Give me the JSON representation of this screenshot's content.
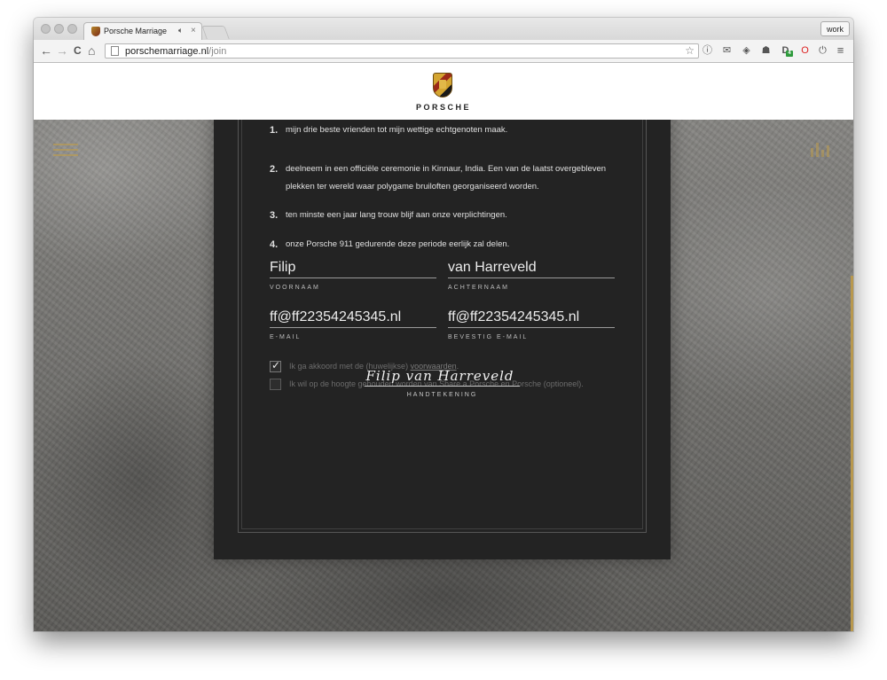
{
  "browser": {
    "tab": {
      "title": "Porsche Marriage",
      "sound_icon": "speaker-icon",
      "close": "×"
    },
    "profile": "work",
    "url": {
      "host": "porschemarriage.nl",
      "path": "/join"
    },
    "nav": {
      "back": "←",
      "forward": "→",
      "reload": "C",
      "home": "⌂"
    },
    "star": "☆",
    "extensions": [
      "1password-icon",
      "inbox-icon",
      "pocket-icon",
      "ghostery-icon",
      "downloads-icon",
      "opera-icon",
      "power-icon",
      "menu-icon"
    ],
    "extension_badge": "4"
  },
  "header": {
    "brand": "PORSCHE"
  },
  "clauses": [
    {
      "num": "1.",
      "text": "mijn drie beste vrienden tot mijn wettige echtgenoten maak."
    },
    {
      "num": "2.",
      "text": "deelneem in een officiële ceremonie in Kinnaur, India. Een van de laatst overgebleven plekken ter wereld waar polygame bruiloften georganiseerd worden."
    },
    {
      "num": "3.",
      "text": "ten minste een jaar lang trouw blijf aan onze verplichtingen."
    },
    {
      "num": "4.",
      "text": "onze Porsche 911 gedurende deze periode eerlijk zal delen."
    }
  ],
  "form": {
    "first_name": {
      "value": "Filip",
      "label": "VOORNAAM"
    },
    "last_name": {
      "value": "van Harreveld",
      "label": "ACHTERNAAM"
    },
    "email": {
      "value": "ff@ff22354245345.nl",
      "label": "E-MAIL"
    },
    "email_confirm": {
      "value": "ff@ff22354245345.nl",
      "label": "BEVESTIG E-MAIL"
    },
    "terms": {
      "checked": true,
      "text": "Ik ga akkoord met de (huwelijkse) ",
      "link": "voorwaarden",
      "suffix": "."
    },
    "newsletter": {
      "checked": false,
      "text": "Ik wil op de hoogte gehouden worden van Share a Porsche en Porsche (optioneel)."
    },
    "signature": {
      "value": "Filip van Harreveld",
      "label": "HANDTEKENING"
    }
  }
}
